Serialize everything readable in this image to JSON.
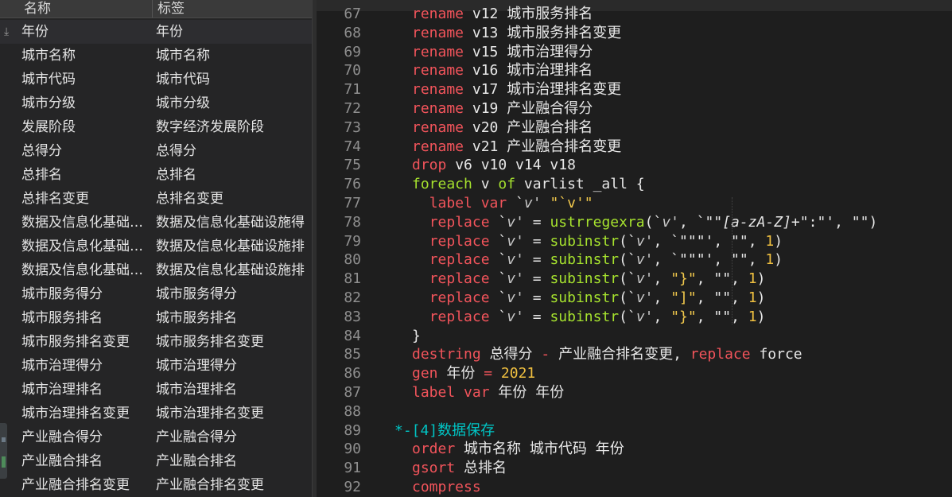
{
  "variables": {
    "header": {
      "name": "名称",
      "label": "标签"
    },
    "rows": [
      {
        "name": "年份",
        "label": "年份"
      },
      {
        "name": "城市名称",
        "label": "城市名称"
      },
      {
        "name": "城市代码",
        "label": "城市代码"
      },
      {
        "name": "城市分级",
        "label": "城市分级"
      },
      {
        "name": "发展阶段",
        "label": "数字经济发展阶段"
      },
      {
        "name": "总得分",
        "label": "总得分"
      },
      {
        "name": "总排名",
        "label": "总排名"
      },
      {
        "name": "总排名变更",
        "label": "总排名变更"
      },
      {
        "name": "数据及信息化基础…",
        "label": "数据及信息化基础设施得"
      },
      {
        "name": "数据及信息化基础…",
        "label": "数据及信息化基础设施排"
      },
      {
        "name": "数据及信息化基础…",
        "label": "数据及信息化基础设施排"
      },
      {
        "name": "城市服务得分",
        "label": "城市服务得分"
      },
      {
        "name": "城市服务排名",
        "label": "城市服务排名"
      },
      {
        "name": "城市服务排名变更",
        "label": "城市服务排名变更"
      },
      {
        "name": "城市治理得分",
        "label": "城市治理得分"
      },
      {
        "name": "城市治理排名",
        "label": "城市治理排名"
      },
      {
        "name": "城市治理排名变更",
        "label": "城市治理排名变更"
      },
      {
        "name": "产业融合得分",
        "label": "产业融合得分"
      },
      {
        "name": "产业融合排名",
        "label": "产业融合排名"
      },
      {
        "name": "产业融合排名变更",
        "label": "产业融合排名变更"
      }
    ]
  },
  "editor": {
    "lines": [
      {
        "n": "67",
        "tokens": [
          [
            "kw",
            "rename"
          ],
          [
            "pl",
            " v12 城市服务排名"
          ]
        ]
      },
      {
        "n": "68",
        "tokens": [
          [
            "kw",
            "rename"
          ],
          [
            "pl",
            " v13 城市服务排名变更"
          ]
        ]
      },
      {
        "n": "69",
        "tokens": [
          [
            "kw",
            "rename"
          ],
          [
            "pl",
            " v15 城市治理得分"
          ]
        ]
      },
      {
        "n": "70",
        "tokens": [
          [
            "kw",
            "rename"
          ],
          [
            "pl",
            " v16 城市治理排名"
          ]
        ]
      },
      {
        "n": "71",
        "tokens": [
          [
            "kw",
            "rename"
          ],
          [
            "pl",
            " v17 城市治理排名变更"
          ]
        ]
      },
      {
        "n": "72",
        "tokens": [
          [
            "kw",
            "rename"
          ],
          [
            "pl",
            " v19 产业融合得分"
          ]
        ]
      },
      {
        "n": "73",
        "tokens": [
          [
            "kw",
            "rename"
          ],
          [
            "pl",
            " v20 产业融合排名"
          ]
        ]
      },
      {
        "n": "74",
        "tokens": [
          [
            "kw",
            "rename"
          ],
          [
            "pl",
            " v21 产业融合排名变更"
          ]
        ]
      },
      {
        "n": "75",
        "tokens": [
          [
            "kw",
            "drop"
          ],
          [
            "pl",
            " v6 v10 v14 v18"
          ]
        ]
      },
      {
        "n": "76",
        "tokens": [
          [
            "fn",
            "foreach"
          ],
          [
            "pl",
            " v "
          ],
          [
            "fn",
            "of"
          ],
          [
            "pl",
            " varlist _all {"
          ]
        ]
      },
      {
        "n": "77",
        "tokens": [
          [
            "pl",
            "  "
          ],
          [
            "kw",
            "label var"
          ],
          [
            "pl",
            " `"
          ],
          [
            "mac",
            "v'"
          ],
          [
            "pl",
            " "
          ],
          [
            "str",
            "\"`v'\""
          ]
        ]
      },
      {
        "n": "78",
        "tokens": [
          [
            "pl",
            "  "
          ],
          [
            "kw",
            "replace"
          ],
          [
            "pl",
            " `"
          ],
          [
            "mac",
            "v'"
          ],
          [
            "pl",
            " = "
          ],
          [
            "fn",
            "ustrregexra"
          ],
          [
            "pl",
            "(`"
          ],
          [
            "mac",
            "v'"
          ],
          [
            "pl",
            ", `\"\""
          ],
          [
            "rx",
            "[a-zA-Z]+"
          ],
          [
            "pl",
            "\":\"', \"\")"
          ]
        ]
      },
      {
        "n": "79",
        "tokens": [
          [
            "pl",
            "  "
          ],
          [
            "kw",
            "replace"
          ],
          [
            "pl",
            " `"
          ],
          [
            "mac",
            "v'"
          ],
          [
            "pl",
            " = "
          ],
          [
            "fn",
            "subinstr"
          ],
          [
            "pl",
            "(`"
          ],
          [
            "mac",
            "v'"
          ],
          [
            "pl",
            ", `\"\"\"', \"\", "
          ],
          [
            "num",
            "1"
          ],
          [
            "pl",
            ")"
          ]
        ]
      },
      {
        "n": "80",
        "tokens": [
          [
            "pl",
            "  "
          ],
          [
            "kw",
            "replace"
          ],
          [
            "pl",
            " `"
          ],
          [
            "mac",
            "v'"
          ],
          [
            "pl",
            " = "
          ],
          [
            "fn",
            "subinstr"
          ],
          [
            "pl",
            "(`"
          ],
          [
            "mac",
            "v'"
          ],
          [
            "pl",
            ", `\"\"\"', \"\", "
          ],
          [
            "num",
            "1"
          ],
          [
            "pl",
            ")"
          ]
        ]
      },
      {
        "n": "81",
        "tokens": [
          [
            "pl",
            "  "
          ],
          [
            "kw",
            "replace"
          ],
          [
            "pl",
            " `"
          ],
          [
            "mac",
            "v'"
          ],
          [
            "pl",
            " = "
          ],
          [
            "fn",
            "subinstr"
          ],
          [
            "pl",
            "(`"
          ],
          [
            "mac",
            "v'"
          ],
          [
            "pl",
            ", "
          ],
          [
            "str",
            "\"}\""
          ],
          [
            "pl",
            ", \"\", "
          ],
          [
            "num",
            "1"
          ],
          [
            "pl",
            ")"
          ]
        ]
      },
      {
        "n": "82",
        "tokens": [
          [
            "pl",
            "  "
          ],
          [
            "kw",
            "replace"
          ],
          [
            "pl",
            " `"
          ],
          [
            "mac",
            "v'"
          ],
          [
            "pl",
            " = "
          ],
          [
            "fn",
            "subinstr"
          ],
          [
            "pl",
            "(`"
          ],
          [
            "mac",
            "v'"
          ],
          [
            "pl",
            ", "
          ],
          [
            "str",
            "\"]\""
          ],
          [
            "pl",
            ", \"\", "
          ],
          [
            "num",
            "1"
          ],
          [
            "pl",
            ")"
          ]
        ]
      },
      {
        "n": "83",
        "tokens": [
          [
            "pl",
            "  "
          ],
          [
            "kw",
            "replace"
          ],
          [
            "pl",
            " `"
          ],
          [
            "mac",
            "v'"
          ],
          [
            "pl",
            " = "
          ],
          [
            "fn",
            "subinstr"
          ],
          [
            "pl",
            "(`"
          ],
          [
            "mac",
            "v'"
          ],
          [
            "pl",
            ", "
          ],
          [
            "str",
            "\"}\""
          ],
          [
            "pl",
            ", \"\", "
          ],
          [
            "num",
            "1"
          ],
          [
            "pl",
            ")"
          ]
        ]
      },
      {
        "n": "84",
        "tokens": [
          [
            "pl",
            "}"
          ]
        ]
      },
      {
        "n": "85",
        "tokens": [
          [
            "kw",
            "destring"
          ],
          [
            "pl",
            " 总得分 "
          ],
          [
            "kw",
            "-"
          ],
          [
            "pl",
            " 产业融合排名变更, "
          ],
          [
            "kw",
            "replace"
          ],
          [
            "pl",
            " force"
          ]
        ]
      },
      {
        "n": "86",
        "tokens": [
          [
            "kw",
            "gen"
          ],
          [
            "pl",
            " 年份 "
          ],
          [
            "kw",
            "="
          ],
          [
            "pl",
            " "
          ],
          [
            "num",
            "2021"
          ]
        ]
      },
      {
        "n": "87",
        "tokens": [
          [
            "kw",
            "label var"
          ],
          [
            "pl",
            " 年份 年份"
          ]
        ]
      },
      {
        "n": "88",
        "tokens": []
      },
      {
        "n": "89",
        "tokens": [
          [
            "cm",
            "*-[4]数据保存"
          ]
        ],
        "outdent": true
      },
      {
        "n": "90",
        "tokens": [
          [
            "kw",
            "order"
          ],
          [
            "pl",
            " 城市名称 城市代码 年份"
          ]
        ]
      },
      {
        "n": "91",
        "tokens": [
          [
            "kw",
            "gsort"
          ],
          [
            "pl",
            " 总排名"
          ]
        ]
      },
      {
        "n": "92",
        "tokens": [
          [
            "kw",
            "compress"
          ]
        ]
      }
    ]
  }
}
